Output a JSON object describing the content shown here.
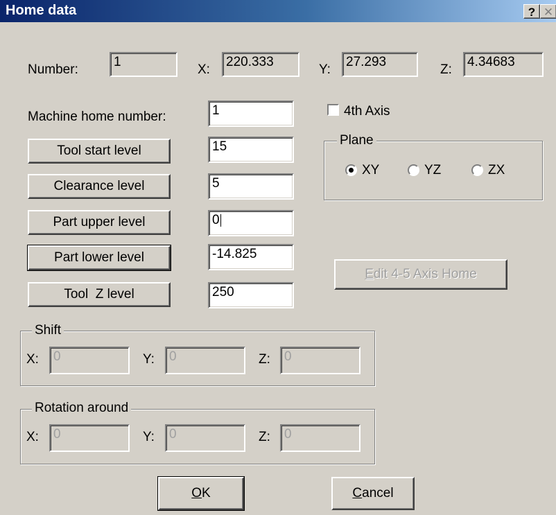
{
  "window": {
    "title": "Home data",
    "help_glyph": "?",
    "close_glyph": "✕"
  },
  "header": {
    "number_label": "Number:",
    "number_value": "1",
    "x_label": "X:",
    "x_value": "220.333",
    "y_label": "Y:",
    "y_value": "27.293",
    "z_label": "Z:",
    "z_value": "4.34683"
  },
  "levels": {
    "machine_home_label": "Machine home number:",
    "machine_home_value": "1",
    "tool_start_label": "Tool start level",
    "tool_start_value": "15",
    "clearance_label": "Clearance level",
    "clearance_value": "5",
    "part_upper_label": "Part upper level",
    "part_upper_value": "0",
    "part_lower_label": "Part lower level",
    "part_lower_value": "-14.825",
    "tool_z_label": "Tool  Z level",
    "tool_z_value": "250"
  },
  "fourth_axis": {
    "label": "4th Axis",
    "checked": false
  },
  "plane": {
    "title": "Plane",
    "options": [
      "XY",
      "YZ",
      "ZX"
    ],
    "selected": "XY"
  },
  "edit_axis_button": {
    "label_underlined": "E",
    "label_rest": "dit 4-5 Axis Home"
  },
  "shift": {
    "title": "Shift",
    "x_label": "X:",
    "x_value": "0",
    "y_label": "Y:",
    "y_value": "0",
    "z_label": "Z:",
    "z_value": "0"
  },
  "rotation": {
    "title": "Rotation around",
    "x_label": "X:",
    "x_value": "0",
    "y_label": "Y:",
    "y_value": "0",
    "z_label": "Z:",
    "z_value": "0"
  },
  "footer": {
    "ok_underlined": "O",
    "ok_rest": "K",
    "cancel_underlined": "C",
    "cancel_rest": "ancel"
  },
  "colors": {
    "title_start": "#0a246a",
    "title_end": "#a6caf0",
    "face": "#d4d0c8",
    "disabled_text": "#a0a0a0"
  }
}
